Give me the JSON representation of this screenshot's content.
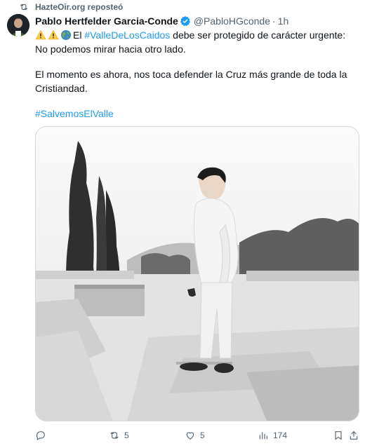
{
  "repost": {
    "text": "HazteOir.org reposteó",
    "icon": "repost-icon"
  },
  "tweet": {
    "author_name": "Pablo Hertfelder Garcia-Conde",
    "handle": "@PabloHGconde",
    "separator": "·",
    "time": "1h",
    "line1_prefix": "El ",
    "line1_hashtag": "#ValleDeLosCaidos",
    "line1_suffix": " debe ser protegido de carácter urgente: No podemos mirar hacia otro lado.",
    "paragraph2": "El momento es ahora, nos toca defender la Cruz más grande de toda la Cristiandad.",
    "hashtag2": "#SalvemosElValle"
  },
  "actions": {
    "reply_count": "",
    "repost_count": "5",
    "like_count": "5",
    "views_count": "174"
  },
  "colors": {
    "accent": "#1d9bf0",
    "muted": "#536471",
    "text": "#0f1419"
  }
}
